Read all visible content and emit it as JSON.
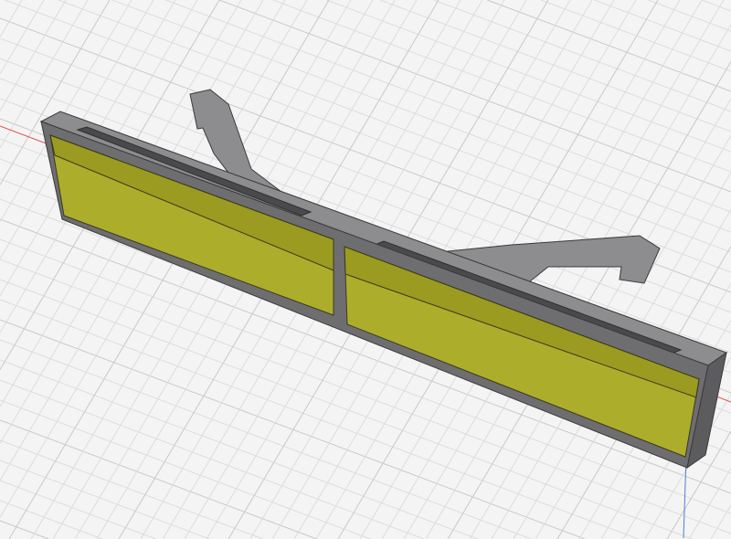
{
  "viewport": {
    "view_type": "3d-perspective",
    "colors": {
      "background": "#f4f4f4",
      "grid_minor": "#dcdcdc",
      "grid_major": "#c8c8c8",
      "axis_x": "#d9534f",
      "axis_z": "#4a7fd6",
      "body_top": "#8d8d8f",
      "body_front": "#6e6e70",
      "body_side": "#5c5c5e",
      "glass": "#b8b820",
      "glass_dark": "#8f8f1a"
    }
  }
}
